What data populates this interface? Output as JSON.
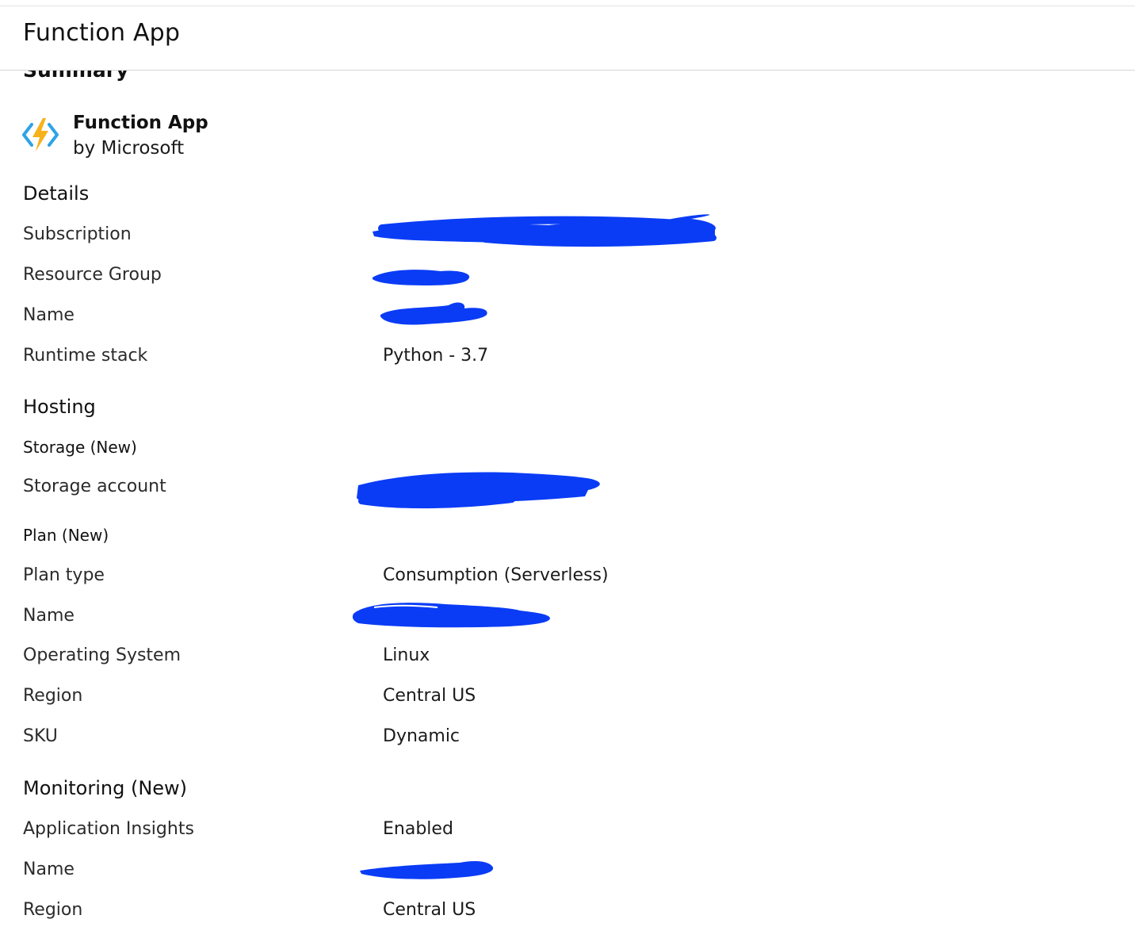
{
  "page": {
    "title": "Function App"
  },
  "summary": {
    "heading": "Summary",
    "product_name": "Function App",
    "product_publisher": "by Microsoft",
    "product_icon": "function-app-lightning-icon"
  },
  "details": {
    "heading": "Details",
    "rows": [
      {
        "label": "Subscription",
        "value": "",
        "redacted": true
      },
      {
        "label": "Resource Group",
        "value": "",
        "redacted": true
      },
      {
        "label": "Name",
        "value": "",
        "redacted": true
      },
      {
        "label": "Runtime stack",
        "value": "Python - 3.7",
        "redacted": false
      }
    ]
  },
  "hosting": {
    "heading": "Hosting",
    "storage_subheading": "Storage (New)",
    "storage_rows": [
      {
        "label": "Storage account",
        "value": "",
        "redacted": true
      }
    ],
    "plan_subheading": "Plan (New)",
    "plan_rows": [
      {
        "label": "Plan type",
        "value": "Consumption (Serverless)",
        "redacted": false
      },
      {
        "label": "Name",
        "value": "",
        "redacted": true
      },
      {
        "label": "Operating System",
        "value": "Linux",
        "redacted": false
      },
      {
        "label": "Region",
        "value": "Central US",
        "redacted": false
      },
      {
        "label": "SKU",
        "value": "Dynamic",
        "redacted": false
      }
    ]
  },
  "monitoring": {
    "heading": "Monitoring (New)",
    "rows": [
      {
        "label": "Application Insights",
        "value": "Enabled",
        "redacted": false
      },
      {
        "label": "Name",
        "value": "",
        "redacted": true
      },
      {
        "label": "Region",
        "value": "Central US",
        "redacted": false
      }
    ]
  },
  "colors": {
    "redaction": "#0a3cf5",
    "icon_blue": "#2fa3e6",
    "icon_bolt": "#f7b21a"
  }
}
